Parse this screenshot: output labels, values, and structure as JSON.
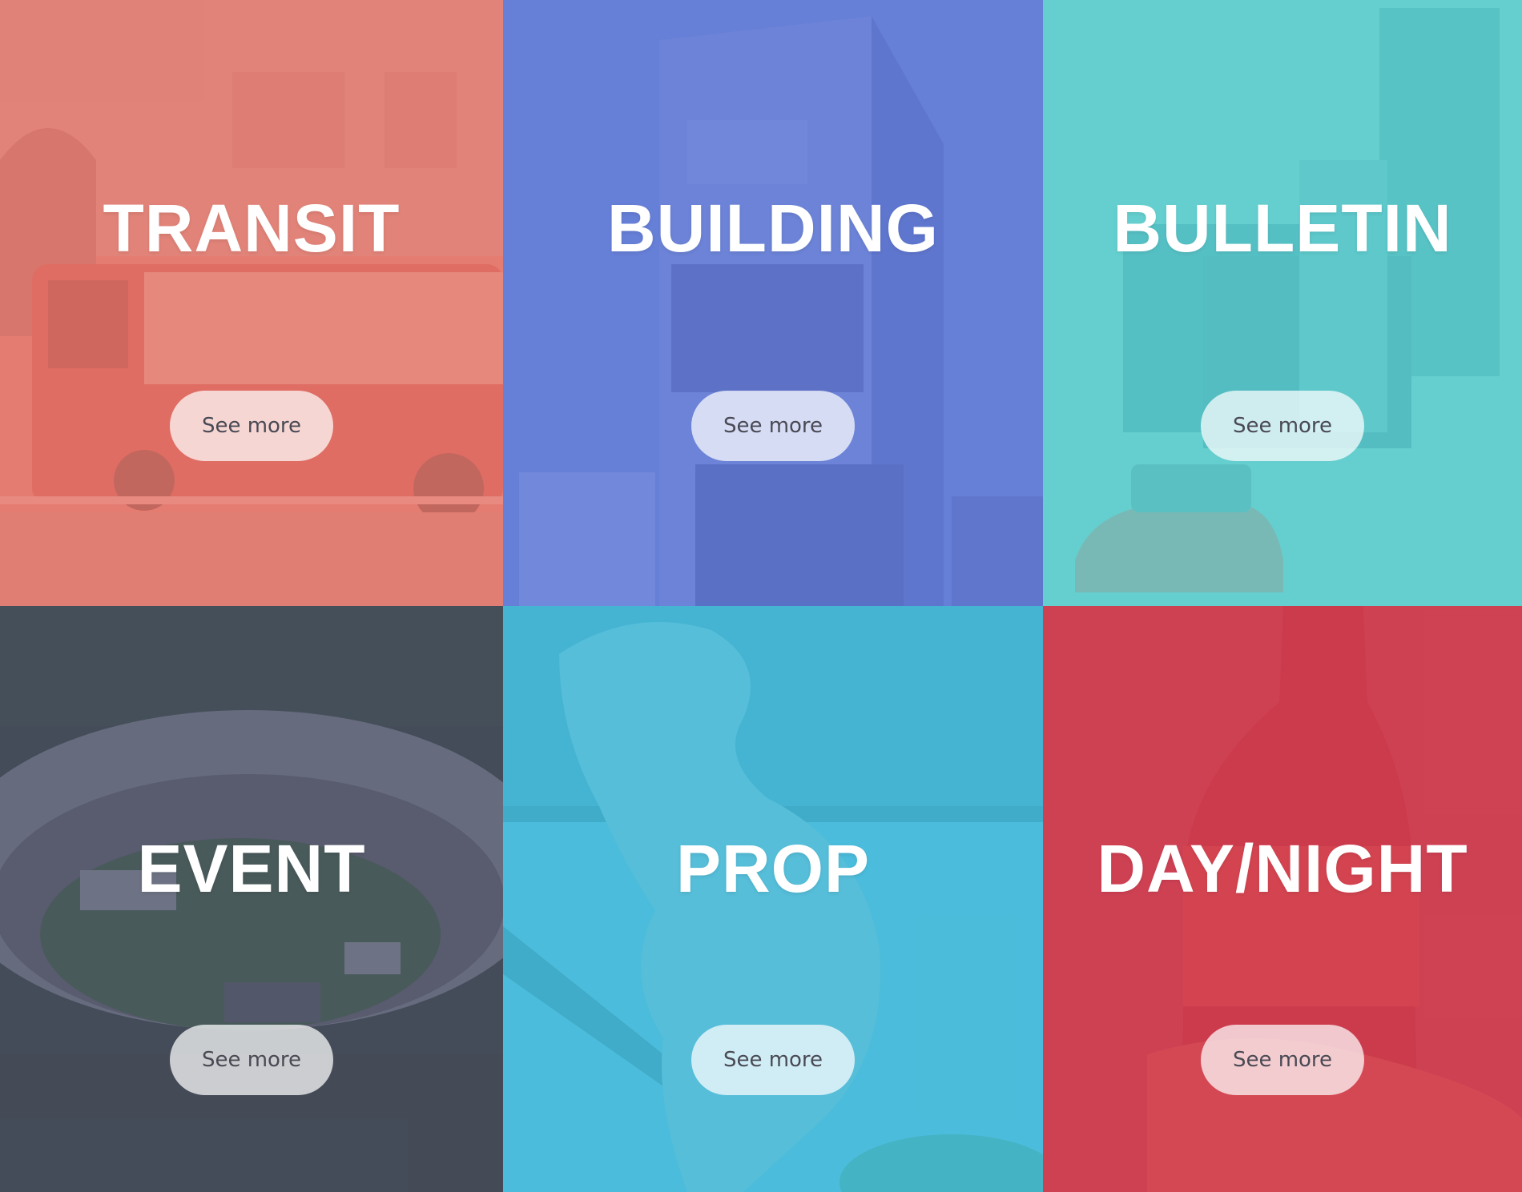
{
  "tiles": [
    {
      "title": "TRANSIT",
      "button_label": "See more",
      "tint": "#e8786e"
    },
    {
      "title": "BUILDING",
      "button_label": "See more",
      "tint": "#647dd7"
    },
    {
      "title": "BULLETIN",
      "button_label": "See more",
      "tint": "#5fcdcd"
    },
    {
      "title": "EVENT",
      "button_label": "See more",
      "tint": "#464e64"
    },
    {
      "title": "PROP",
      "button_label": "See more",
      "tint": "#46b9d7"
    },
    {
      "title": "DAY/NIGHT",
      "button_label": "See more",
      "tint": "#cd3c50"
    }
  ]
}
